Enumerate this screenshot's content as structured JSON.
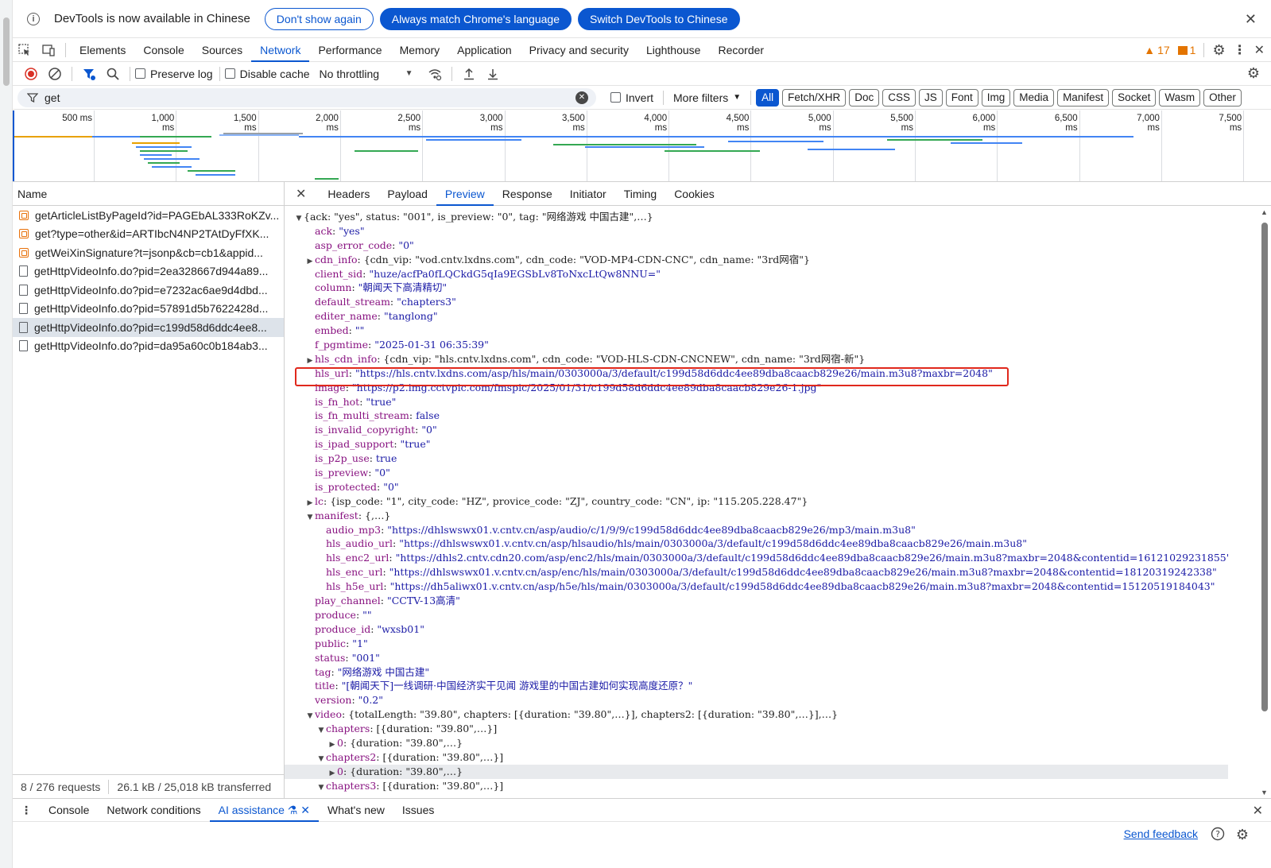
{
  "infobar": {
    "message": "DevTools is now available in Chinese",
    "btn_dont_show": "Don't show again",
    "btn_always_match": "Always match Chrome's language",
    "btn_switch": "Switch DevTools to Chinese"
  },
  "panels": [
    "Elements",
    "Console",
    "Sources",
    "Network",
    "Performance",
    "Memory",
    "Application",
    "Privacy and security",
    "Lighthouse",
    "Recorder"
  ],
  "badges": {
    "warnings": "17",
    "issues": "1"
  },
  "toolbar": {
    "preserve_log": "Preserve log",
    "disable_cache": "Disable cache",
    "throttling": "No throttling"
  },
  "filter": {
    "value": "get",
    "invert": "Invert",
    "more_filters": "More filters",
    "types": [
      "All",
      "Fetch/XHR",
      "Doc",
      "CSS",
      "JS",
      "Font",
      "Img",
      "Media",
      "Manifest",
      "Socket",
      "Wasm",
      "Other"
    ]
  },
  "timeline": {
    "ticks": [
      "500 ms",
      "1,000 ms",
      "1,500 ms",
      "2,000 ms",
      "2,500 ms",
      "3,000 ms",
      "3,500 ms",
      "4,000 ms",
      "4,500 ms",
      "5,000 ms",
      "5,500 ms",
      "6,000 ms",
      "6,500 ms",
      "7,000 ms",
      "7,500 ms"
    ]
  },
  "requests": {
    "header": "Name",
    "items": [
      {
        "name": "getArticleListByPageId?id=PAGEbAL333RoKZv...",
        "type": "xhr"
      },
      {
        "name": "get?type=other&id=ARTIbcN4NP2TAtDyFfXK...",
        "type": "xhr"
      },
      {
        "name": "getWeiXinSignature?t=jsonp&cb=cb1&appid...",
        "type": "xhr"
      },
      {
        "name": "getHttpVideoInfo.do?pid=2ea328667d944a89...",
        "type": "doc"
      },
      {
        "name": "getHttpVideoInfo.do?pid=e7232ac6ae9d4dbd...",
        "type": "doc"
      },
      {
        "name": "getHttpVideoInfo.do?pid=57891d5b7622428d...",
        "type": "doc"
      },
      {
        "name": "getHttpVideoInfo.do?pid=c199d58d6ddc4ee8...",
        "type": "doc",
        "selected": true
      },
      {
        "name": "getHttpVideoInfo.do?pid=da95a60c0b184ab3...",
        "type": "doc"
      }
    ],
    "summary_requests": "8 / 276 requests",
    "summary_transferred": "26.1 kB / 25,018 kB transferred"
  },
  "detail_tabs": [
    "Headers",
    "Payload",
    "Preview",
    "Response",
    "Initiator",
    "Timing",
    "Cookies"
  ],
  "preview_lines": [
    {
      "i": 0,
      "tw": "down",
      "t": "{ack: \"yes\", status: \"001\", is_preview: \"0\", tag: \"网络游戏 中国古建\",…}"
    },
    {
      "i": 1,
      "k": "ack",
      "v": "\"yes\""
    },
    {
      "i": 1,
      "k": "asp_error_code",
      "v": "\"0\""
    },
    {
      "i": 1,
      "tw": "right",
      "k": "cdn_info",
      "v": "{cdn_vip: \"vod.cntv.lxdns.com\", cdn_code: \"VOD-MP4-CDN-CNC\", cdn_name: \"3rd网宿\"}",
      "plain": true
    },
    {
      "i": 1,
      "k": "client_sid",
      "v": "\"huze/acfPa0fLQCkdG5qIa9EGSbLv8ToNxcLtQw8NNU=\""
    },
    {
      "i": 1,
      "k": "column",
      "v": "\"朝闻天下高清精切\""
    },
    {
      "i": 1,
      "k": "default_stream",
      "v": "\"chapters3\""
    },
    {
      "i": 1,
      "k": "editer_name",
      "v": "\"tanglong\""
    },
    {
      "i": 1,
      "k": "embed",
      "v": "\"\""
    },
    {
      "i": 1,
      "k": "f_pgmtime",
      "v": "\"2025-01-31 06:35:39\""
    },
    {
      "i": 1,
      "tw": "right",
      "k": "hls_cdn_info",
      "v": "{cdn_vip: \"hls.cntv.lxdns.com\", cdn_code: \"VOD-HLS-CDN-CNCNEW\", cdn_name: \"3rd网宿-新\"}",
      "plain": true
    },
    {
      "i": 1,
      "k": "hls_url",
      "v": "\"https://hls.cntv.lxdns.com/asp/hls/main/0303000a/3/default/c199d58d6ddc4ee89dba8caacb829e26/main.m3u8?maxbr=2048\""
    },
    {
      "i": 1,
      "k": "image",
      "v": "\"https://p2.img.cctvpic.com/fmspic/2025/01/31/c199d58d6ddc4ee89dba8caacb829e26-1.jpg\""
    },
    {
      "i": 1,
      "k": "is_fn_hot",
      "v": "\"true\""
    },
    {
      "i": 1,
      "k": "is_fn_multi_stream",
      "v": "false"
    },
    {
      "i": 1,
      "k": "is_invalid_copyright",
      "v": "\"0\""
    },
    {
      "i": 1,
      "k": "is_ipad_support",
      "v": "\"true\""
    },
    {
      "i": 1,
      "k": "is_p2p_use",
      "v": "true"
    },
    {
      "i": 1,
      "k": "is_preview",
      "v": "\"0\""
    },
    {
      "i": 1,
      "k": "is_protected",
      "v": "\"0\""
    },
    {
      "i": 1,
      "tw": "right",
      "k": "lc",
      "v": "{isp_code: \"1\", city_code: \"HZ\", provice_code: \"ZJ\", country_code: \"CN\", ip: \"115.205.228.47\"}",
      "plain": true
    },
    {
      "i": 1,
      "tw": "down",
      "k": "manifest",
      "v": "{,…}",
      "plain": true
    },
    {
      "i": 2,
      "k": "audio_mp3",
      "v": "\"https://dhlswswx01.v.cntv.cn/asp/audio/c/1/9/9/c199d58d6ddc4ee89dba8caacb829e26/mp3/main.m3u8\""
    },
    {
      "i": 2,
      "k": "hls_audio_url",
      "v": "\"https://dhlswswx01.v.cntv.cn/asp/hlsaudio/hls/main/0303000a/3/default/c199d58d6ddc4ee89dba8caacb829e26/main.m3u8\""
    },
    {
      "i": 2,
      "k": "hls_enc2_url",
      "v": "\"https://dhls2.cntv.cdn20.com/asp/enc2/hls/main/0303000a/3/default/c199d58d6ddc4ee89dba8caacb829e26/main.m3u8?maxbr=2048&contentid=16121029231855\""
    },
    {
      "i": 2,
      "k": "hls_enc_url",
      "v": "\"https://dhlswswx01.v.cntv.cn/asp/enc/hls/main/0303000a/3/default/c199d58d6ddc4ee89dba8caacb829e26/main.m3u8?maxbr=2048&contentid=18120319242338\""
    },
    {
      "i": 2,
      "k": "hls_h5e_url",
      "v": "\"https://dh5aliwx01.v.cntv.cn/asp/h5e/hls/main/0303000a/3/default/c199d58d6ddc4ee89dba8caacb829e26/main.m3u8?maxbr=2048&contentid=15120519184043\""
    },
    {
      "i": 1,
      "k": "play_channel",
      "v": "\"CCTV-13高清\""
    },
    {
      "i": 1,
      "k": "produce",
      "v": "\"\""
    },
    {
      "i": 1,
      "k": "produce_id",
      "v": "\"wxsb01\""
    },
    {
      "i": 1,
      "k": "public",
      "v": "\"1\""
    },
    {
      "i": 1,
      "k": "status",
      "v": "\"001\""
    },
    {
      "i": 1,
      "k": "tag",
      "v": "\"网络游戏 中国古建\""
    },
    {
      "i": 1,
      "k": "title",
      "v": "\"[朝闻天下]一线调研·中国经济实干见闻 游戏里的中国古建如何实现高度还原？\""
    },
    {
      "i": 1,
      "k": "version",
      "v": "\"0.2\""
    },
    {
      "i": 1,
      "tw": "down",
      "k": "video",
      "v": "{totalLength: \"39.80\", chapters: [{duration: \"39.80\",…}], chapters2: [{duration: \"39.80\",…}],…}",
      "plain": true
    },
    {
      "i": 2,
      "tw": "down",
      "k": "chapters",
      "v": "[{duration: \"39.80\",…}]",
      "plain": true
    },
    {
      "i": 3,
      "tw": "right",
      "k": "0",
      "v": "{duration: \"39.80\",…}",
      "plain": true
    },
    {
      "i": 2,
      "tw": "down",
      "k": "chapters2",
      "v": "[{duration: \"39.80\",…}]",
      "plain": true
    },
    {
      "i": 3,
      "tw": "right",
      "k": "0",
      "v": "{duration: \"39.80\",…}",
      "plain": true,
      "hl": true
    },
    {
      "i": 2,
      "tw": "down",
      "k": "chapters3",
      "v": "[{duration: \"39.80\",…}]",
      "plain": true
    }
  ],
  "drawer": {
    "tabs": [
      "Console",
      "Network conditions",
      "AI assistance",
      "What's new",
      "Issues"
    ],
    "active": "AI assistance"
  },
  "footer": {
    "send_feedback": "Send feedback"
  },
  "colors": {
    "accent": "#0b57d0",
    "key": "#881280",
    "string": "#1a1aa6",
    "highlight_box": "#e0281c"
  }
}
